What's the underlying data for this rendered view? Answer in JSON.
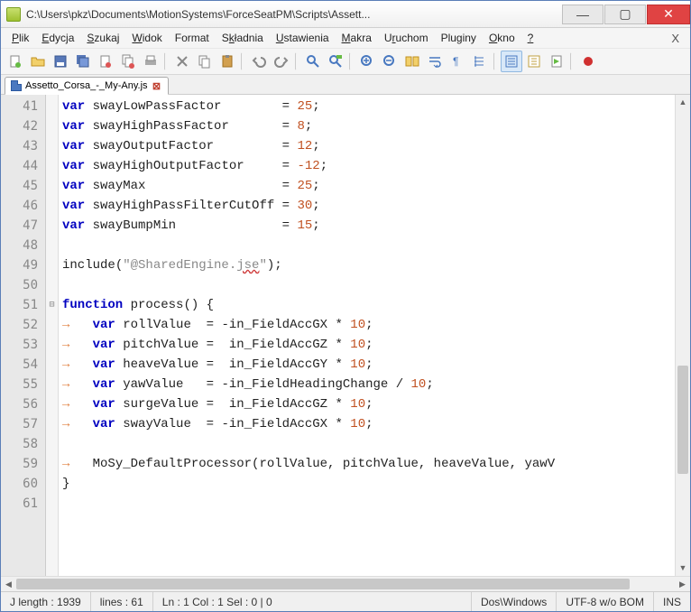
{
  "window": {
    "title": "C:\\Users\\pkz\\Documents\\MotionSystems\\ForceSeatPM\\Scripts\\Assett..."
  },
  "menu": {
    "plik": "Plik",
    "edycja": "Edycja",
    "szukaj": "Szukaj",
    "widok": "Widok",
    "format": "Format",
    "skladnia": "Składnia",
    "ustawienia": "Ustawienia",
    "makra": "Makra",
    "uruchom": "Uruchom",
    "pluginy": "Pluginy",
    "okno": "Okno",
    "help": "?",
    "x": "X"
  },
  "tab": {
    "label": "Assetto_Corsa_-_My-Any.js"
  },
  "lines": {
    "start": 41,
    "end": 61
  },
  "code": {
    "l41": {
      "name": "swayLowPassFactor",
      "val": "25"
    },
    "l42": {
      "name": "swayHighPassFactor",
      "val": "8"
    },
    "l43": {
      "name": "swayOutputFactor",
      "val": "12"
    },
    "l44": {
      "name": "swayHighOutputFactor",
      "val": "-12"
    },
    "l45": {
      "name": "swayMax",
      "val": "25"
    },
    "l46": {
      "name": "swayHighPassFilterCutOff",
      "val": "30"
    },
    "l47": {
      "name": "swayBumpMin",
      "val": "15"
    },
    "l49": {
      "fn": "include",
      "arg_prefix": "\"@SharedEngine.",
      "arg_wavy": "jse",
      "arg_suffix": "\""
    },
    "l51": {
      "kw1": "function",
      "name": "process"
    },
    "l52": {
      "name": "rollValue",
      "expr_pre": "-in_FieldAccGX * ",
      "n": "10"
    },
    "l53": {
      "name": "pitchValue",
      "expr_pre": " in_FieldAccGZ * ",
      "n": "10"
    },
    "l54": {
      "name": "heaveValue",
      "expr_pre": " in_FieldAccGY * ",
      "n": "10"
    },
    "l55": {
      "name": "yawValue",
      "expr_pre": "-in_FieldHeadingChange / ",
      "n": "10"
    },
    "l56": {
      "name": "surgeValue",
      "expr_pre": " in_FieldAccGZ * ",
      "n": "10"
    },
    "l57": {
      "name": "swayValue",
      "expr_pre": "-in_FieldAccGX * ",
      "n": "10"
    },
    "l59": {
      "call": "MoSy_DefaultProcessor(rollValue, pitchValue, heaveValue, yawV"
    }
  },
  "status": {
    "length": "J length : 1939",
    "lines": "lines : 61",
    "pos": "Ln : 1   Col : 1   Sel : 0 | 0",
    "eol": "Dos\\Windows",
    "enc": "UTF-8 w/o BOM",
    "mode": "INS"
  }
}
